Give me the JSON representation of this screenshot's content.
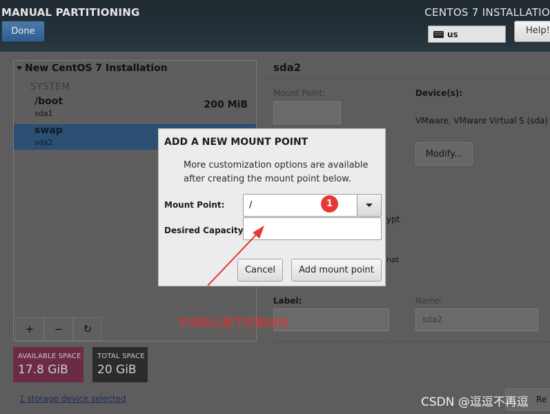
{
  "header": {
    "title_left": "MANUAL PARTITIONING",
    "title_right": "CENTOS 7 INSTALLATIO",
    "done_label": "Done",
    "keyboard_layout": "us",
    "help_label": "Help!"
  },
  "partitions": {
    "install_title": "New CentOS 7 Installation",
    "section": "SYSTEM",
    "items": [
      {
        "mount": "/boot",
        "device": "sda1",
        "size": "200 MiB",
        "selected": false
      },
      {
        "mount": "swap",
        "device": "sda2",
        "size": "",
        "selected": true
      }
    ],
    "toolbar": {
      "add": "+",
      "remove": "−",
      "refresh": "↻"
    }
  },
  "space": {
    "available_label": "AVAILABLE SPACE",
    "available_value": "17.8 GiB",
    "total_label": "TOTAL SPACE",
    "total_value": "20 GiB",
    "storage_link": "1 storage device selected"
  },
  "details": {
    "title": "sda2",
    "mount_point_label": "Mount Point:",
    "devices_label": "Device(s):",
    "devices_value": "VMware, VMware Virtual S (sda)",
    "modify_label": "Modify...",
    "crypt_fragment": "ypt",
    "nat_fragment": "nat",
    "label_label": "Label:",
    "name_label": "Name:",
    "name_value": "sda2",
    "reset_label": "Re"
  },
  "dialog": {
    "title": "ADD A NEW MOUNT POINT",
    "description": "More customization options are available after creating the mount point below.",
    "mount_point_label": "Mount Point:",
    "mount_point_value": "/",
    "capacity_label": "Desired Capacity:",
    "capacity_value": "",
    "cancel_label": "Cancel",
    "add_label": "Add mount point"
  },
  "annotation": {
    "badge": "1",
    "note": "不填默认剩下的都给他",
    "color": "#e53935"
  },
  "watermark": "CSDN @逗逗不再逗"
}
